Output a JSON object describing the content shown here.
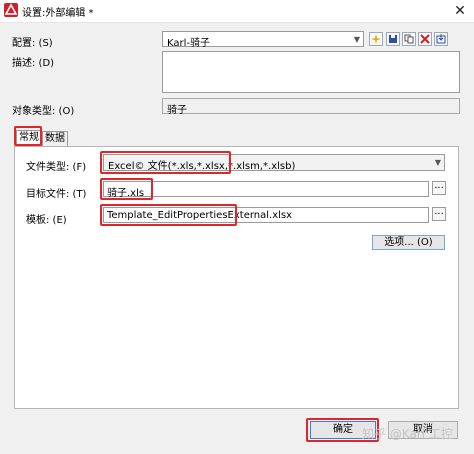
{
  "window": {
    "title": "设置:外部编辑 *",
    "close": "✕"
  },
  "form": {
    "config_label": "配置: (S)",
    "config_value": "Karl-骑子",
    "desc_label": "描述: (D)",
    "desc_value": "",
    "objtype_label": "对象类型: (O)",
    "objtype_value": "骑子"
  },
  "toolbar": {
    "icons": [
      "new-icon",
      "save-icon",
      "copy-icon",
      "delete-icon",
      "export-icon"
    ],
    "colors": {
      "new": "#e8a317",
      "save": "#2a4fa8",
      "copy": "#555555",
      "delete": "#d0202a",
      "export": "#2a4fa8"
    }
  },
  "tabs": [
    {
      "label": "常规",
      "active": true
    },
    {
      "label": "数据",
      "active": false
    }
  ],
  "general": {
    "filetype_label": "文件类型: (F)",
    "filetype_value": "Excel© 文件(*.xls,*.xlsx,*.xlsm,*.xlsb)",
    "target_label": "目标文件: (T)",
    "target_value": "骑子.xls",
    "template_label": "模板: (E)",
    "template_value": "Template_EditPropertiesExternal.xlsx",
    "browse": "...",
    "options_button": "选项... (O)"
  },
  "footer": {
    "ok_button": "确定",
    "cancel_button": "取消",
    "watermark": "知乎 @Karl 工控"
  },
  "highlight_color": "#e0252b"
}
